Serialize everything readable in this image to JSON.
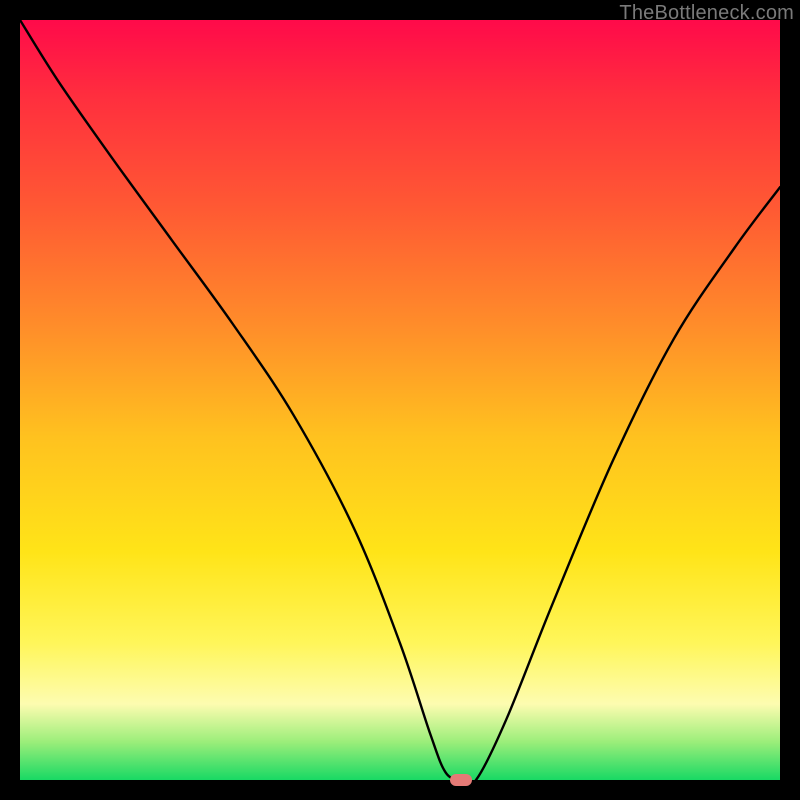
{
  "watermark": "TheBottleneck.com",
  "chart_data": {
    "type": "line",
    "title": "",
    "xlabel": "",
    "ylabel": "",
    "xlim": [
      0,
      100
    ],
    "ylim": [
      0,
      100
    ],
    "grid": false,
    "legend": false,
    "series": [
      {
        "name": "bottleneck-curve",
        "x": [
          0,
          5,
          12,
          20,
          28,
          36,
          44,
          50,
          54,
          56,
          58,
          60,
          64,
          70,
          78,
          86,
          94,
          100
        ],
        "y": [
          100,
          92,
          82,
          71,
          60,
          48,
          33,
          18,
          6,
          1,
          0,
          0,
          8,
          23,
          42,
          58,
          70,
          78
        ]
      }
    ],
    "marker": {
      "x": 58,
      "y": 0,
      "color": "#e47a76"
    },
    "background_gradient": {
      "stops": [
        {
          "pos": 0,
          "color": "#ff0a4a"
        },
        {
          "pos": 25,
          "color": "#ff5a33"
        },
        {
          "pos": 55,
          "color": "#ffc21f"
        },
        {
          "pos": 82,
          "color": "#fff65a"
        },
        {
          "pos": 95,
          "color": "#9bee7a"
        },
        {
          "pos": 100,
          "color": "#18d964"
        }
      ]
    }
  }
}
